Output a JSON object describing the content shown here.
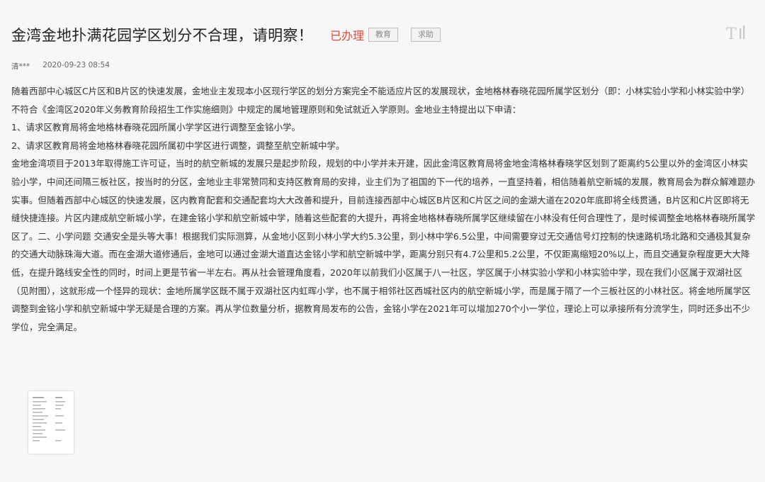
{
  "post": {
    "title": "金湾金地扑满花园学区划分不合理，请明察！",
    "status": "已办理",
    "tags": [
      "教育",
      "求助"
    ],
    "author": "清***",
    "datetime": "2020-09-23 08:54"
  },
  "toolbar": {
    "font_size_icon": "text-size-icon",
    "font_size_glyph": "T⁞"
  },
  "content": {
    "paragraphs": [
      "随着西部中心城区C片区和B片区的快速发展，金地业主发现本小区现行学区的划分方案完全不能适应片区的发展现状，金地格林春晓花园所属学区划分（即：小林实验小学和小林实验中学）不符合《金湾区2020年义务教育阶段招生工作实施细则》中规定的属地管理原则和免试就近入学原则。金地业主特提出以下申请：",
      "1、请求区教育局将金地格林春晓花园所属小学学区进行调整至金铭小学。",
      "2、请求区教育局将金地格林春晓花园所属初中学区进行调整，调整至航空新城中学。",
      "金地金湾项目于2013年取得施工许可证，当时的航空新城的发展只是起步阶段，规划的中小学并未开建，因此金湾区教育局将金地金湾格林春晓学区划到了距离约5公里以外的金湾区小林实验小学，中间还间隔三板社区，按当时的分区，金地业主非常赞同和支持区教育局的安排，业主们为了祖国的下一代的培养，一直坚持着，相信随着航空新城的发展，教育局会为群众解难题办实事。但随着西部中心城区的快速发展，区内教育配套和交通配套均大大改善和提升，目前连接西部中心城区B片区和C片区之间的金湖大道在2020年底即将全线贯通，B片区和C片区即将无缝快捷连接。片区内建成航空新城小学，在建金铭小学和航空新城中学，随着这些配套的大提升，再将金地格林春晓所属学区继续留在小林没有任何合理性了，是时候调整金地格林春晓所属学区了。二、小学问题  交通安全是头等大事！根据我们实际测算，从金地小区到小林小学大约5.3公里，到小林中学6.5公里，中间需要穿过无交通信号灯控制的快速路机场北路和交通极其复杂的交通大动脉珠海大道。而在金湖大道修通后，金地可以通过金湖大道直达金铭小学和航空新城中学，距离分别只有4.7公里和5.2公里，不仅距离缩短20%以上，而且交通复杂程度更大大降低，在提升路线安全性的同时，时间上更是节省一半左右。再从社会管理角度看，2020年以前我们小区属于八一社区，学区属于小林实验小学和小林实验中学，现在我们小区属于双湖社区（见附图），这就形成一个怪异的现状：金地所属学区既不属于双湖社区内虹晖小学，也不属于相邻社区西城社区内的航空新城小学，而是属于隔了一个三板社区的小林社区。将金地所属学区调整到金铭小学和航空新城中学无疑是合理的方案。再从学位数量分析，据教育局发布的公告，金铭小学在2021年可以增加270个小一学位，理论上可以承接所有分流学生，同时还多出不少学位，完全满足。"
    ]
  },
  "attachment": {
    "icon": "document-thumbnail-icon"
  }
}
